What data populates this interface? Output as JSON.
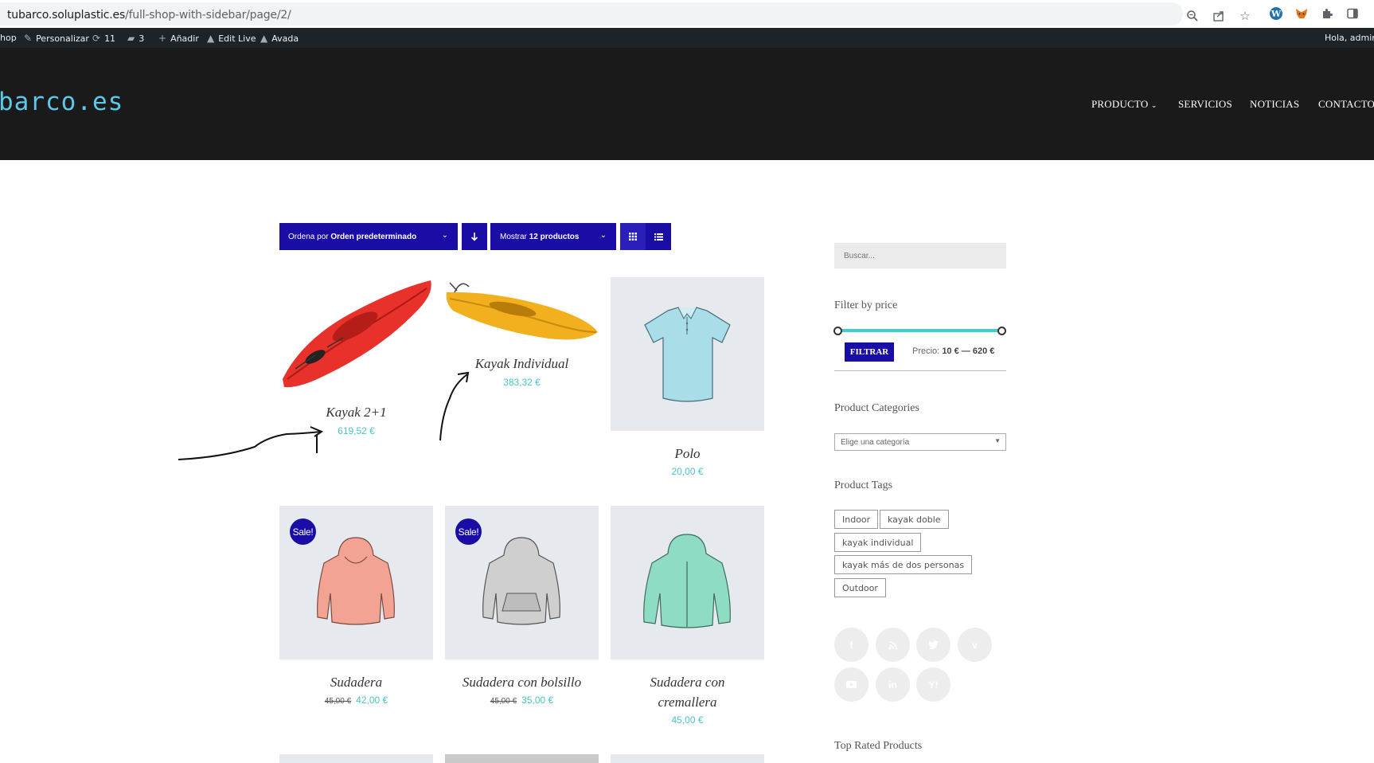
{
  "browser": {
    "url_host": "tubarco.soluplastic.es",
    "url_path": "/full-shop-with-sidebar/page/2/"
  },
  "admin_bar": {
    "shop": "hop",
    "customize": "Personalizar",
    "updates": "11",
    "comments": "3",
    "new": "Añadir",
    "edit_live": "Edit Live",
    "avada": "Avada",
    "greeting": "Hola, admin"
  },
  "header": {
    "logo": "barco.es",
    "nav": [
      "PRODUCTO",
      "SERVICIOS",
      "NOTICIAS",
      "CONTACTO"
    ]
  },
  "toolbar": {
    "orderby_prefix": "Ordena por",
    "orderby_value": "Orden predeterminado",
    "show_prefix": "Mostrar",
    "show_value": "12 productos"
  },
  "products": [
    {
      "name": "Kayak 2+1",
      "price": "619,52 €",
      "old_price": "",
      "image": "red-kayak"
    },
    {
      "name": "Kayak Individual",
      "price": "383,32 €",
      "old_price": "",
      "image": "yellow-kayak"
    },
    {
      "name": "Polo",
      "price": "20,00 €",
      "old_price": "",
      "image": "polo-shirt"
    },
    {
      "name": "Sudadera",
      "price": "42,00 €",
      "old_price": "45,00 €",
      "sale": "Sale!",
      "image": "pink-hoodie"
    },
    {
      "name": "Sudadera con bolsillo",
      "price": "35,00 €",
      "old_price": "45,00 €",
      "sale": "Sale!",
      "image": "grey-hoodie"
    },
    {
      "name_line1": "Sudadera con",
      "name_line2": "cremallera",
      "price": "45,00 €",
      "old_price": "",
      "image": "green-zip-hoodie"
    }
  ],
  "sidebar": {
    "search_placeholder": "Buscar...",
    "filter_title": "Filter by price",
    "filter_button": "FILTRAR",
    "price_label": "Precio:",
    "price_range": "10 € — 620 €",
    "categories_title": "Product Categories",
    "categories_select": "Elige una categoría",
    "tags_title": "Product Tags",
    "tags": [
      "Indoor",
      "kayak doble",
      "kayak individual",
      "kayak más de dos personas",
      "Outdoor"
    ],
    "social": [
      "f",
      "rss",
      "twitter",
      "v",
      "youtube",
      "in",
      "Y"
    ],
    "top_rated_title": "Top Rated Products"
  },
  "colors": {
    "accent": "#1a0da6",
    "price": "#4bc3c6",
    "header_bg": "#1a1a1a",
    "logo": "#5cc8ea"
  }
}
